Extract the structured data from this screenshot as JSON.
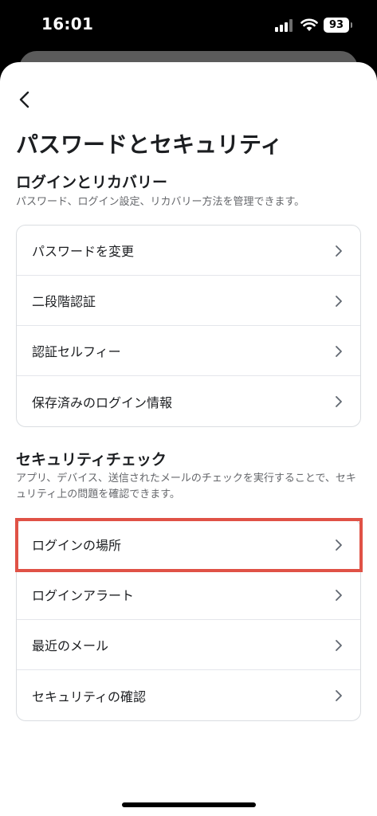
{
  "status_bar": {
    "time": "16:01",
    "battery": "93"
  },
  "header": {
    "back_icon": "chevron-left-icon",
    "title": "パスワードとセキュリティ"
  },
  "login_section": {
    "title": "ログインとリカバリー",
    "description": "パスワード、ログイン設定、リカバリー方法を管理できます。",
    "items": [
      {
        "label": "パスワードを変更"
      },
      {
        "label": "二段階認証"
      },
      {
        "label": "認証セルフィー"
      },
      {
        "label": "保存済みのログイン情報"
      }
    ]
  },
  "security_section": {
    "title": "セキュリティチェック",
    "description": "アプリ、デバイス、送信されたメールのチェックを実行することで、セキュリティ上の問題を確認できます。",
    "items": [
      {
        "label": "ログインの場所"
      },
      {
        "label": "ログインアラート"
      },
      {
        "label": "最近のメール"
      },
      {
        "label": "セキュリティの確認"
      }
    ]
  },
  "highlight_color": "#e05246",
  "row_icon": "chevron-right-icon"
}
